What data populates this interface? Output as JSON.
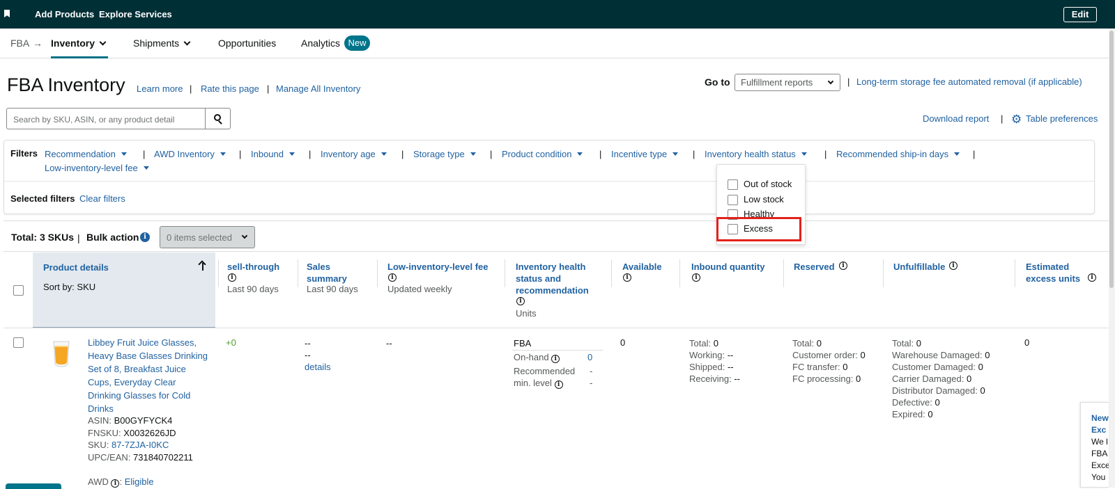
{
  "topbar": {
    "add_products": "Add Products",
    "explore_services": "Explore Services",
    "edit": "Edit"
  },
  "nav": {
    "fba": "FBA",
    "arrow": "→",
    "inventory": "Inventory",
    "shipments": "Shipments",
    "opportunities": "Opportunities",
    "analytics": "Analytics",
    "new_badge": "New"
  },
  "header": {
    "title": "FBA Inventory",
    "learn_more": "Learn more",
    "rate_page": "Rate this page",
    "manage_all": "Manage All Inventory",
    "goto_label": "Go to",
    "goto_value": "Fulfillment reports",
    "storage_link": "Long-term storage fee automated removal (if applicable)",
    "sep": "|"
  },
  "search": {
    "placeholder": "Search by SKU, ASIN, or any product detail"
  },
  "actions": {
    "download": "Download report",
    "table_preferences": "Table preferences"
  },
  "filters": {
    "label": "Filters",
    "items": [
      "Recommendation",
      "AWD Inventory",
      "Inbound",
      "Inventory age",
      "Storage type",
      "Product condition",
      "Incentive type",
      "Inventory health status",
      "Recommended ship-in days",
      "Low-inventory-level fee"
    ],
    "selected_label": "Selected filters",
    "clear": "Clear filters"
  },
  "health_dropdown": {
    "options": [
      "Out of stock",
      "Low stock",
      "Healthy",
      "Excess"
    ]
  },
  "bulk": {
    "total": "Total: 3 SKUs",
    "bulk_action": "Bulk action",
    "items_selected": "0 items selected"
  },
  "columns": {
    "product_details": "Product details",
    "sort_by": "Sort by: SKU",
    "sell_through": "sell-through",
    "last90": "Last 90 days",
    "sales_summary_1": "Sales",
    "sales_summary_2": "summary",
    "low_fee": "Low-inventory-level fee",
    "updated_weekly": "Updated weekly",
    "health_1": "Inventory health",
    "health_2": "status and",
    "health_3": "recommendation",
    "units": "Units",
    "available": "Available",
    "inbound_qty": "Inbound quantity",
    "reserved": "Reserved",
    "unfulfillable": "Unfulfillable",
    "excess_1": "Estimated",
    "excess_2": "excess units"
  },
  "row": {
    "product_name": "Libbey Fruit Juice Glasses, Heavy Base Glasses Drinking Set of 8, Breakfast Juice Cups, Everyday Clear Drinking Glasses for Cold Drinks",
    "asin_label": "ASIN:",
    "asin": "B00GYFYCK4",
    "fnsku_label": "FNSKU:",
    "fnsku": "X0032626JD",
    "sku_label": "SKU:",
    "sku": "87-7ZJA-I0KC",
    "upc_label": "UPC/EAN:",
    "upc": "731840702211",
    "awd_label": "AWD",
    "awd_value": "Eligible",
    "sell_through": "+0",
    "sales_1": "--",
    "sales_2": "--",
    "sales_details": "details",
    "low_fee": "--",
    "fba": "FBA",
    "on_hand_label": "On-hand",
    "on_hand": "0",
    "rec_min_1": "Recommended",
    "rec_min_2": "min. level",
    "rec_min_val": "-",
    "available": "0",
    "inbound_total": "Total:",
    "inbound_total_v": "0",
    "working": "Working:",
    "working_v": "--",
    "shipped": "Shipped:",
    "shipped_v": "--",
    "receiving": "Receiving:",
    "receiving_v": "--",
    "res_total": "Total:",
    "res_total_v": "0",
    "cust_order": "Customer order:",
    "cust_order_v": "0",
    "fc_transfer": "FC transfer:",
    "fc_transfer_v": "0",
    "fc_processing": "FC processing:",
    "fc_processing_v": "0",
    "unf_total": "Total:",
    "unf_total_v": "0",
    "wh_damaged": "Warehouse Damaged:",
    "wh_damaged_v": "0",
    "cust_damaged": "Customer Damaged:",
    "cust_damaged_v": "0",
    "carrier_damaged": "Carrier Damaged:",
    "carrier_damaged_v": "0",
    "dist_damaged": "Distributor Damaged:",
    "dist_damaged_v": "0",
    "defective": "Defective:",
    "defective_v": "0",
    "expired": "Expired:",
    "expired_v": "0",
    "excess": "0"
  },
  "news_panel": {
    "lines": [
      "New",
      "Exc",
      "We l",
      "FBA",
      "Exce",
      "You"
    ]
  },
  "colors": {
    "topbar": "#002f36",
    "link": "#2162a1",
    "accent": "#007185",
    "highlight": "#e3211c"
  },
  "icons": [
    "bookmark-icon",
    "chevron-down-icon",
    "search-icon",
    "gear-icon",
    "info-icon",
    "sort-up-icon",
    "checkbox-icon"
  ]
}
